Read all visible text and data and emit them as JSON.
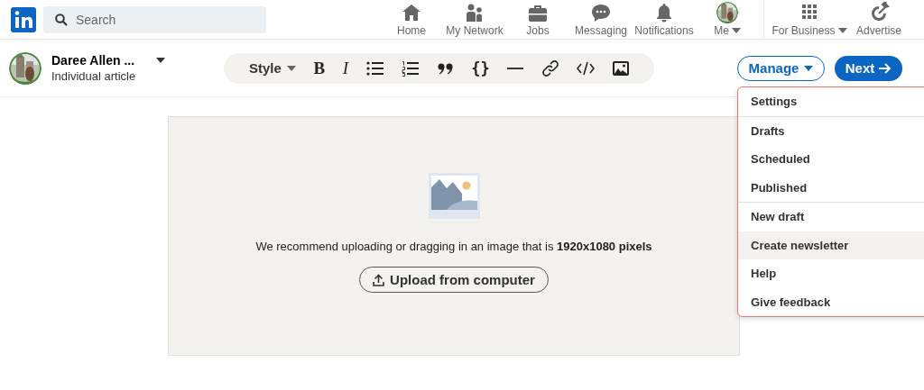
{
  "top_nav": {
    "search": {
      "placeholder": "Search"
    },
    "items": [
      {
        "label": "Home",
        "caret": false
      },
      {
        "label": "My Network",
        "caret": false
      },
      {
        "label": "Jobs",
        "caret": false
      },
      {
        "label": "Messaging",
        "caret": false
      },
      {
        "label": "Notifications",
        "caret": false
      },
      {
        "label": "Me",
        "caret": true
      }
    ],
    "business_items": [
      {
        "label": "For Business",
        "caret": true
      },
      {
        "label": "Advertise",
        "caret": false
      }
    ]
  },
  "author": {
    "name": "Daree Allen ...",
    "subtitle": "Individual article"
  },
  "toolbar": {
    "style_label": "Style",
    "bold": "B",
    "italic": "I",
    "code_block": "{}"
  },
  "manage": {
    "label": "Manage"
  },
  "next": {
    "label": "Next"
  },
  "manage_menu": {
    "groups": [
      [
        {
          "label": "Settings",
          "highlighted": false
        }
      ],
      [
        {
          "label": "Drafts",
          "highlighted": false
        },
        {
          "label": "Scheduled",
          "highlighted": false
        },
        {
          "label": "Published",
          "highlighted": false
        }
      ],
      [
        {
          "label": "New draft",
          "highlighted": false
        },
        {
          "label": "Create newsletter",
          "highlighted": true
        },
        {
          "label": "Help",
          "highlighted": false
        },
        {
          "label": "Give feedback",
          "highlighted": false
        }
      ]
    ]
  },
  "cover_upload": {
    "message": "We recommend uploading or dragging in an image that is **1920x1080 pixels**",
    "button": "Upload from computer"
  }
}
